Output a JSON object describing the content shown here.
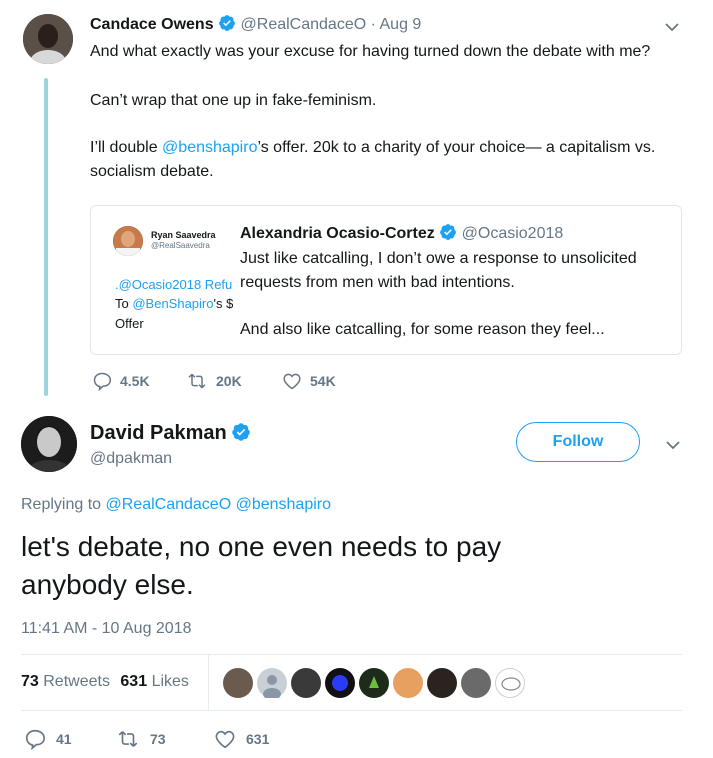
{
  "tweet1": {
    "name": "Candace Owens",
    "handle": "@RealCandaceO",
    "date": "· Aug 9",
    "line1": "And what exactly was your excuse for having turned down the debate with me?",
    "line2": "Can’t wrap that one up in fake-feminism.",
    "line3_pre": "I’ll double ",
    "line3_mention": "@benshapiro",
    "line3_post": "’s offer. 20k to a charity of your choice— a capitalism vs.",
    "line4": "socialism debate.",
    "quote": {
      "thumb_name": "Ryan Saavedra",
      "thumb_handle": "@RealSaavedra",
      "thumb_line1": ".@Ocasio2018 Refu",
      "thumb_line2_pre": "To ",
      "thumb_line2_mention": "@BenShapiro",
      "thumb_line2_post": "'s $",
      "thumb_line3": "Offer",
      "name": "Alexandria Ocasio-Cortez",
      "handle": "@Ocasio2018",
      "line1": "Just like catcalling, I don’t owe a response to unsolicited",
      "line2": "requests from men with bad intentions.",
      "line3": "And also like catcalling, for some reason they feel..."
    },
    "replies": "4.5K",
    "retweets": "20K",
    "likes": "54K"
  },
  "tweet2": {
    "name": "David Pakman",
    "handle": "@dpakman",
    "follow_label": "Follow",
    "replying_label": "Replying to",
    "replying_mention1": "@RealCandaceO",
    "replying_mention2": "@benshapiro",
    "text_line1": "let's debate, no one even needs to pay",
    "text_line2": "anybody else.",
    "timestamp": "11:41 AM - 10 Aug 2018",
    "retweets_count": "73",
    "retweets_label": "Retweets",
    "likes_count": "631",
    "likes_label": "Likes",
    "action_replies": "41",
    "action_retweets": "73",
    "action_likes": "631"
  },
  "colors": {
    "link": "#1da1f2",
    "muted": "#657786",
    "thread_line": "#9fd3dc",
    "verified": "#1da1f2"
  }
}
